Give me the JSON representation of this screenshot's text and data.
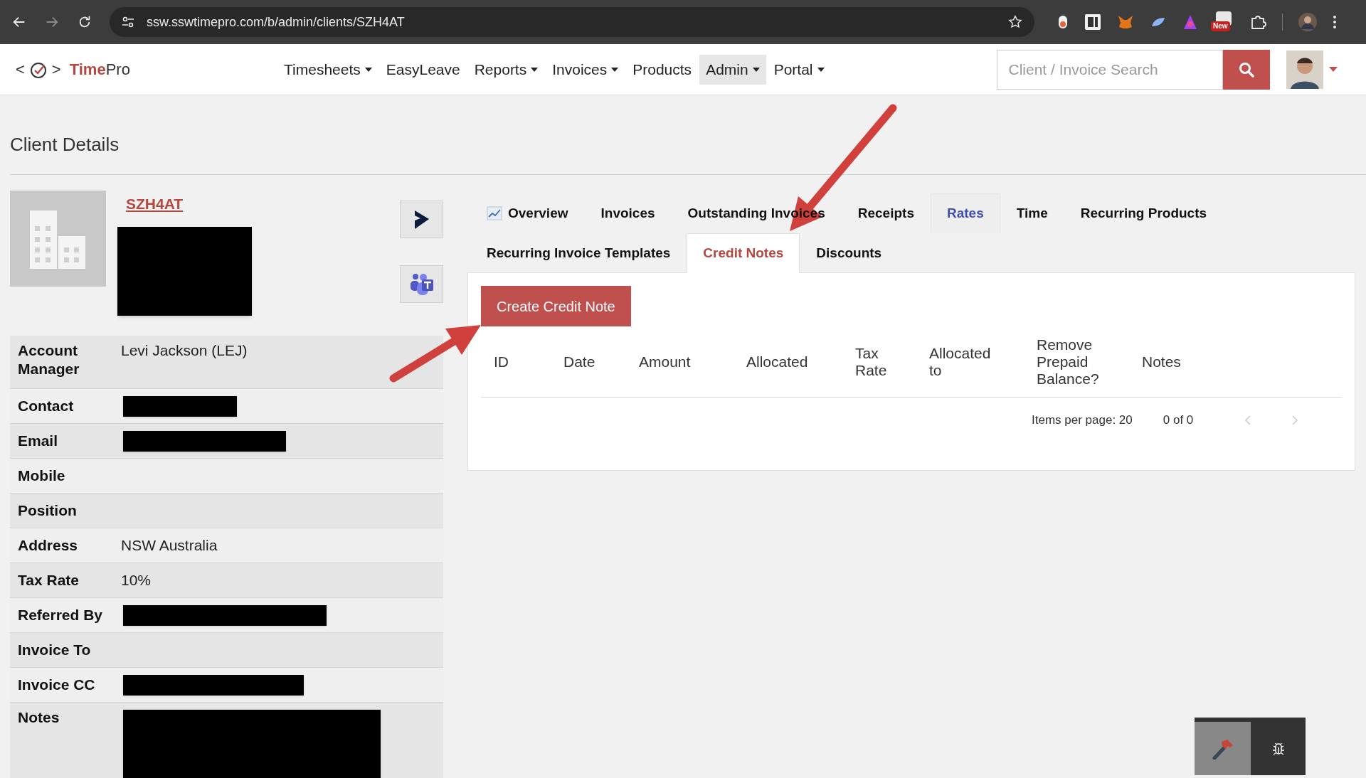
{
  "browser": {
    "url": "ssw.sswtimepro.com/b/admin/clients/SZH4AT",
    "extension_badge": "New"
  },
  "app_nav": {
    "logo": {
      "open": "<",
      "accent": "Time",
      "rest": "Pro",
      "close": ">"
    },
    "items": [
      {
        "label": "Timesheets",
        "dropdown": true,
        "selected": false
      },
      {
        "label": "EasyLeave",
        "dropdown": false,
        "selected": false
      },
      {
        "label": "Reports",
        "dropdown": true,
        "selected": false
      },
      {
        "label": "Invoices",
        "dropdown": true,
        "selected": false
      },
      {
        "label": "Products",
        "dropdown": false,
        "selected": false
      },
      {
        "label": "Admin",
        "dropdown": true,
        "selected": true
      },
      {
        "label": "Portal",
        "dropdown": true,
        "selected": false
      }
    ],
    "search": {
      "placeholder": "Client / Invoice Search"
    }
  },
  "page": {
    "title": "Client Details"
  },
  "client": {
    "code": "SZH4AT",
    "logo_redacted": true,
    "fields": [
      {
        "label": "Account Manager",
        "value": "Levi Jackson (LEJ)"
      },
      {
        "label": "Contact",
        "redacted": true
      },
      {
        "label": "Email",
        "redacted": true
      },
      {
        "label": "Mobile"
      },
      {
        "label": "Position"
      },
      {
        "label": "Address",
        "value": "NSW Australia"
      },
      {
        "label": "Tax Rate",
        "value": "10%"
      },
      {
        "label": "Referred By",
        "redacted": true
      },
      {
        "label": "Invoice To"
      },
      {
        "label": "Invoice CC",
        "redacted": true
      },
      {
        "label": "Notes",
        "redacted": true
      }
    ]
  },
  "tabs": [
    {
      "label": "Overview",
      "selected": false,
      "highlighted": false
    },
    {
      "label": "Invoices",
      "selected": false,
      "highlighted": false
    },
    {
      "label": "Outstanding Invoices",
      "selected": false,
      "highlighted": false
    },
    {
      "label": "Receipts",
      "selected": false,
      "highlighted": false
    },
    {
      "label": "Rates",
      "selected": false,
      "highlighted": true
    },
    {
      "label": "Time",
      "selected": false,
      "highlighted": false
    },
    {
      "label": "Recurring Products",
      "selected": false,
      "highlighted": false
    },
    {
      "label": "Recurring Invoice Templates",
      "selected": false,
      "highlighted": false
    },
    {
      "label": "Credit Notes",
      "selected": true,
      "highlighted": false
    },
    {
      "label": "Discounts",
      "selected": false,
      "highlighted": false
    }
  ],
  "credit_notes": {
    "create_button": "Create Credit Note",
    "columns": [
      "ID",
      "Date",
      "Amount",
      "Allocated",
      "Tax Rate",
      "Allocated to",
      "Remove Prepaid Balance?",
      "Notes"
    ],
    "pager": {
      "items_per_page": "Items per page: 20",
      "range": "0 of 0"
    }
  }
}
